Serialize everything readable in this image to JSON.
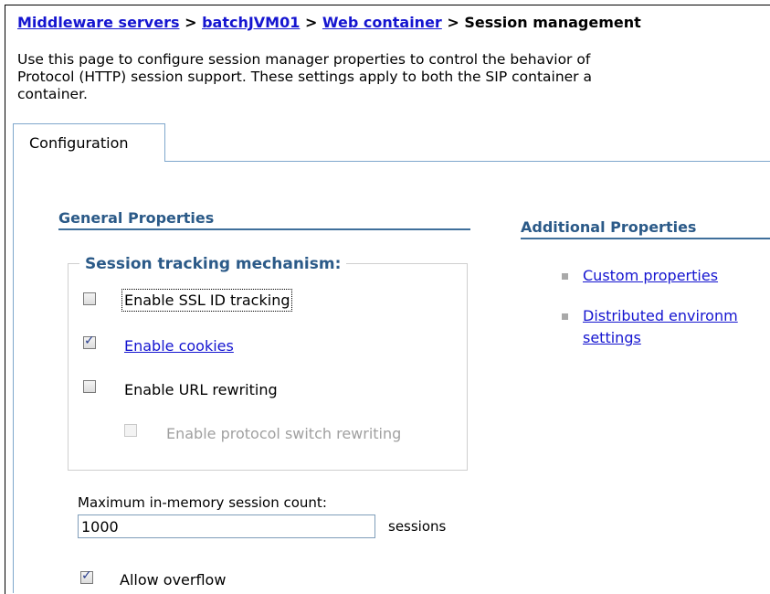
{
  "breadcrumb": {
    "items": [
      "Middleware servers",
      "batchJVM01",
      "Web container"
    ],
    "separator": ">",
    "current": "Session management"
  },
  "description": {
    "line1": "Use this page to configure session manager properties to control the behavior of",
    "line2": "Protocol (HTTP) session support. These settings apply to both the SIP container a",
    "line3": "container."
  },
  "tabs": [
    {
      "label": "Configuration",
      "active": true
    }
  ],
  "general_properties": {
    "title": "General Properties",
    "tracking": {
      "legend": "Session tracking mechanism:",
      "options": [
        {
          "label": "Enable SSL ID tracking",
          "checked": false,
          "enabled": true,
          "is_link": false,
          "focused": true
        },
        {
          "label": "Enable cookies",
          "checked": true,
          "enabled": true,
          "is_link": true
        },
        {
          "label": "Enable URL rewriting",
          "checked": false,
          "enabled": true,
          "is_link": false
        },
        {
          "label": "Enable protocol switch rewriting",
          "checked": false,
          "enabled": false,
          "is_link": false
        }
      ]
    },
    "max_sessions": {
      "label": "Maximum in-memory session count:",
      "value": "1000",
      "unit": "sessions"
    },
    "allow_overflow": {
      "label": "Allow overflow",
      "checked": true
    }
  },
  "additional_properties": {
    "title": "Additional Properties",
    "links": [
      {
        "label": "Custom properties"
      },
      {
        "label_line1": "Distributed environm",
        "label_line2": "settings"
      }
    ]
  },
  "colors": {
    "link": "#1515d0",
    "section_title": "#2b5a88",
    "tab_border": "#7fa7cc"
  }
}
